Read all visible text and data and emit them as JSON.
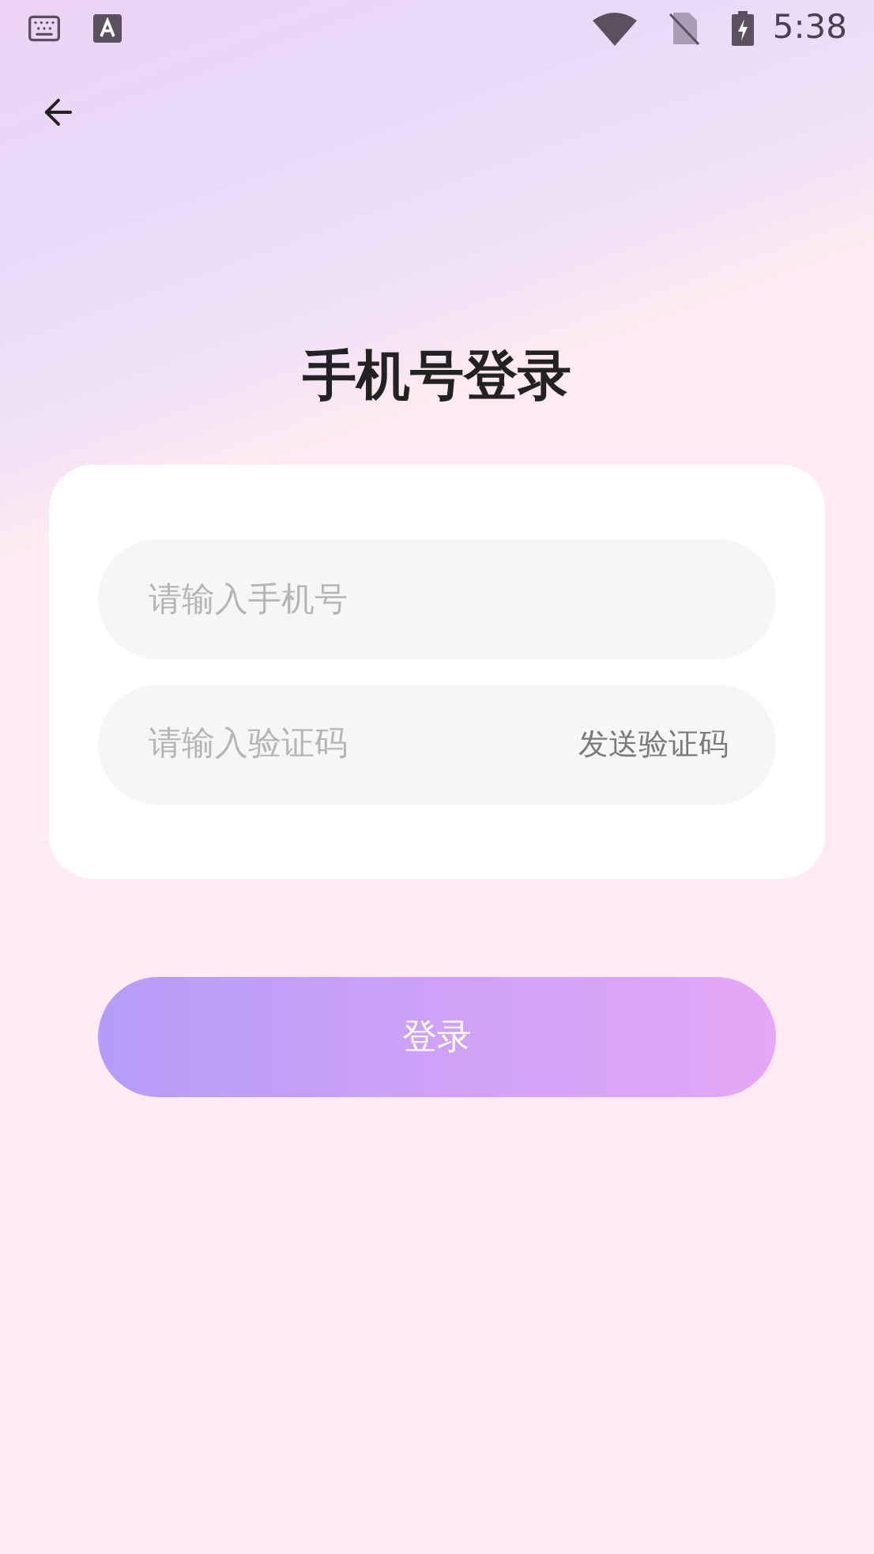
{
  "status_bar": {
    "time": "5:38"
  },
  "title": "手机号登录",
  "phone_field": {
    "placeholder": "请输入手机号"
  },
  "code_field": {
    "placeholder": "请输入验证码",
    "action": "发送验证码"
  },
  "login_button": {
    "label": "登录"
  }
}
